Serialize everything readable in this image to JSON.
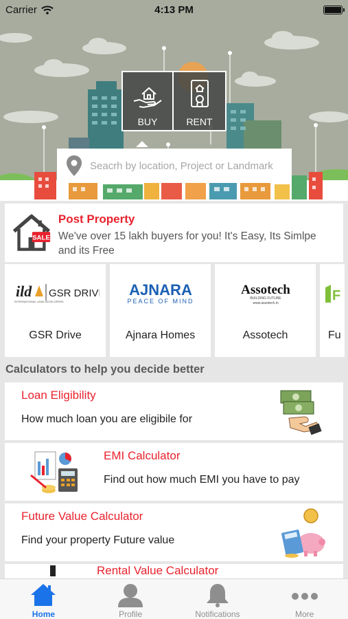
{
  "status_bar": {
    "carrier": "Carrier",
    "time": "4:13 PM"
  },
  "hero": {
    "tabs": [
      {
        "label": "BUY",
        "icon": "hand-house-icon"
      },
      {
        "label": "RENT",
        "icon": "rent-document-icon"
      }
    ],
    "search": {
      "placeholder": "Seacrh by location, Project or Landmark",
      "icon": "location-pin-icon"
    }
  },
  "post_property": {
    "title": "Post Property",
    "description": "We've over 15 lakh buyers for you! It's Easy, Its Simlpe and its Free",
    "icon": "house-sale-icon",
    "sale_tag": "SALE"
  },
  "builders": [
    {
      "name": "GSR Drive",
      "logo_text": "GSR DRIVE",
      "logo_brand": "ild",
      "logo_sub": "INTERNATIONAL LAND DEVELOPERS"
    },
    {
      "name": "Ajnara Homes",
      "logo_text": "AJNARA",
      "logo_sub": "PEACE OF MIND"
    },
    {
      "name": "Assotech",
      "logo_text": "Assotech",
      "logo_sub": "BUILDING FUTURE",
      "logo_url": "www.assotech.in"
    },
    {
      "name": "Fu",
      "logo_text": "F"
    }
  ],
  "calculators_heading": "Calculators to help you decide better",
  "calculators": [
    {
      "title": "Loan Eligibility",
      "description": "How much loan you are eligibile for",
      "icon": "money-hand-icon"
    },
    {
      "title": "EMI Calculator",
      "description": "Find out how much EMI you have to pay",
      "icon": "emi-charts-icon"
    },
    {
      "title": "Future Value Calculator",
      "description": "Find your property Future value",
      "icon": "piggy-bank-icon"
    },
    {
      "title": "Rental Value Calculator",
      "description": "",
      "icon": "rental-icon"
    }
  ],
  "tab_bar": [
    {
      "label": "Home",
      "icon": "home-icon",
      "active": true
    },
    {
      "label": "Profile",
      "icon": "profile-icon",
      "active": false
    },
    {
      "label": "Notifications",
      "icon": "bell-icon",
      "active": false
    },
    {
      "label": "More",
      "icon": "more-dots-icon",
      "active": false
    }
  ],
  "colors": {
    "accent_red": "#e8222d",
    "active_tab": "#1a73e8",
    "hero_bg": "#a7ac9e"
  }
}
